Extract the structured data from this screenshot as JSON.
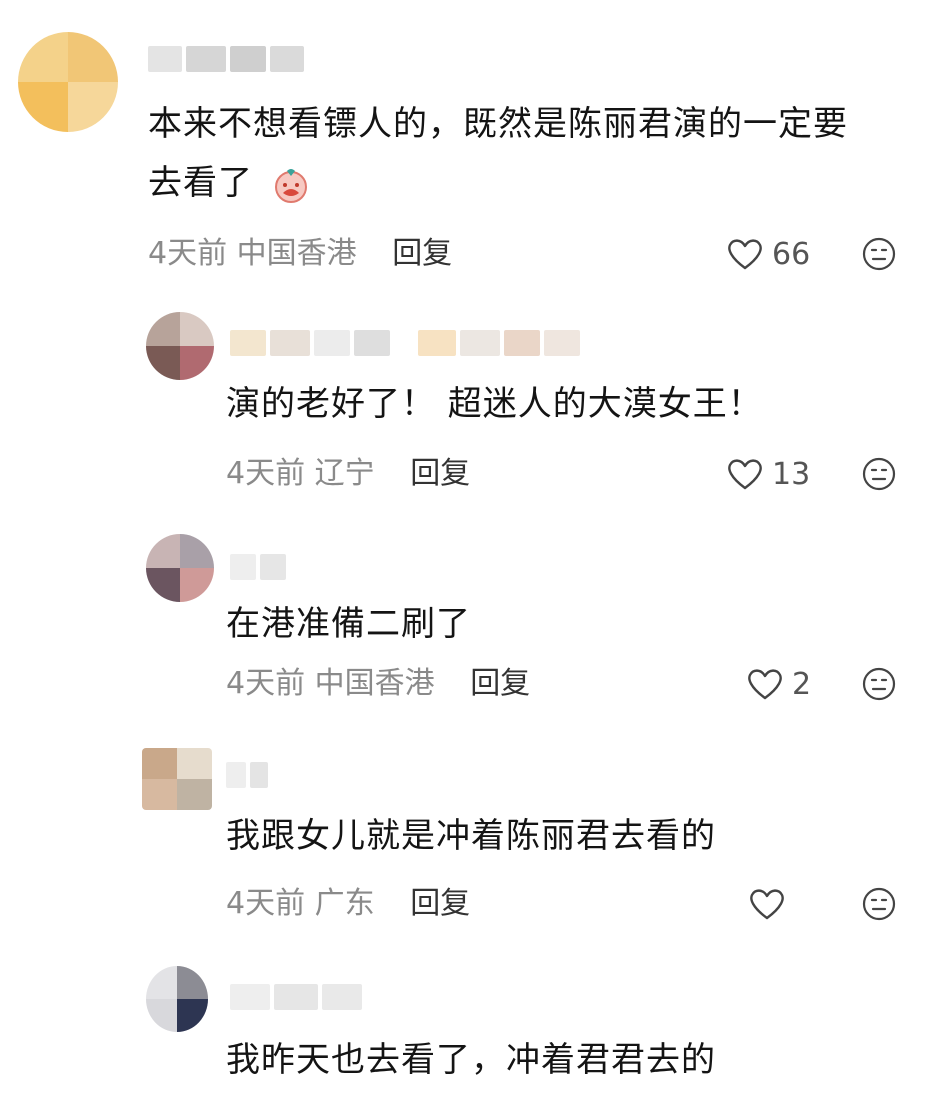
{
  "colors": {
    "text": "#141414",
    "meta": "#8a8a8a",
    "reply": "#333333",
    "icon": "#555555"
  },
  "comments": [
    {
      "text_line1": "本来不想看镖人的，既然是陈丽君演的一定要",
      "text_line2": "去看了",
      "emoji": "crying-face-emoji",
      "time": "4天前",
      "location": "中国香港",
      "reply": "回复",
      "likes": "66"
    }
  ],
  "replies": [
    {
      "text": "演的老好了！ 超迷人的大漠女王！",
      "time": "4天前",
      "location": "辽宁",
      "reply": "回复",
      "likes": "13"
    },
    {
      "text": "在港准備二刷了",
      "time": "4天前",
      "location": "中国香港",
      "reply": "回复",
      "likes": "2"
    },
    {
      "text": "我跟女儿就是冲着陈丽君去看的",
      "time": "4天前",
      "location": "广东",
      "reply": "回复",
      "likes": ""
    },
    {
      "text": "我昨天也去看了，冲着君君去的"
    }
  ]
}
